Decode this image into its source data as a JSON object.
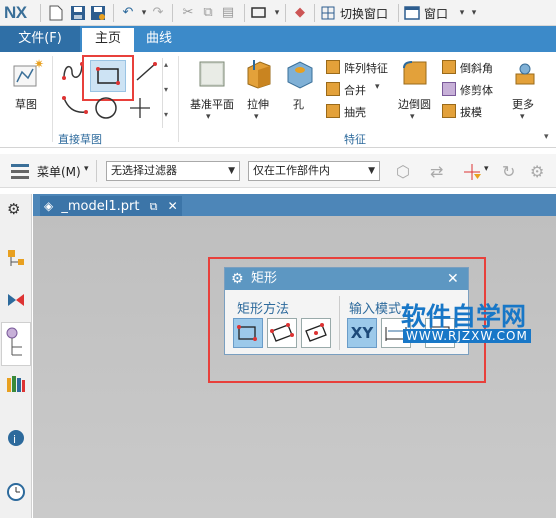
{
  "app": {
    "logo": "NX"
  },
  "quick_toolbar": {
    "switch_window_label": "切换窗口",
    "window_menu_label": "窗口"
  },
  "tabs": [
    {
      "label": "文件(F)"
    },
    {
      "label": "主页"
    },
    {
      "label": "曲线"
    }
  ],
  "ribbon": {
    "sketch_label": "草图",
    "direct_sketch_group": "直接草图",
    "datum_plane_label": "基准平面",
    "extrude_label": "拉伸",
    "hole_label": "孔",
    "pattern_feature_label": "阵列特征",
    "unite_label": "合并",
    "shell_label": "抽壳",
    "edge_blend_label": "边倒圆",
    "chamfer_label": "倒斜角",
    "trim_body_label": "修剪体",
    "draft_label": "拔模",
    "more_label": "更多",
    "feature_group": "特征"
  },
  "command_bar": {
    "menu_label": "菜单(M)",
    "filter_value": "无选择过滤器",
    "scope_value": "仅在工作部件内"
  },
  "document": {
    "tab_label": "_model1.prt"
  },
  "dialog": {
    "title": "矩形",
    "method_label": "矩形方法",
    "input_mode_label": "输入模式",
    "xy_label": "XY"
  },
  "watermark": {
    "text": "软件自学网",
    "url": "WWW.RJZXW.COM"
  },
  "colors": {
    "tab_blue": "#3c8ac9",
    "highlight_red": "#e8403b",
    "dialog_title": "#5d97c2"
  }
}
